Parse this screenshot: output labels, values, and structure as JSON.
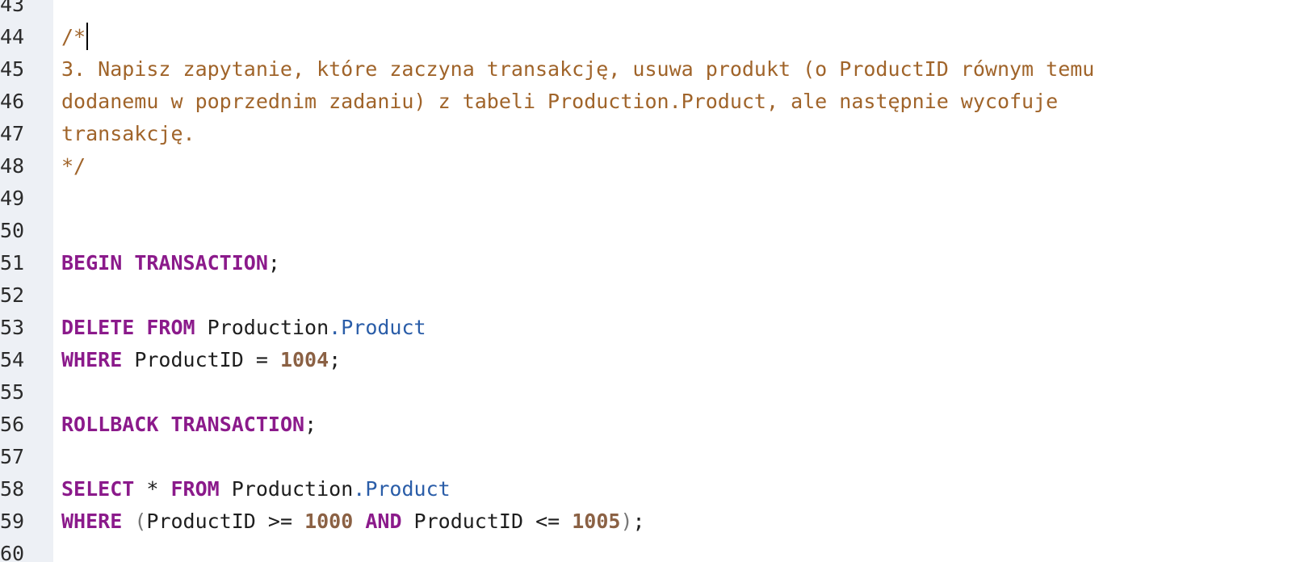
{
  "editor": {
    "lines": [
      {
        "num": "43",
        "tokens": []
      },
      {
        "num": "44",
        "tokens": [
          {
            "text": "/*",
            "cls": "c",
            "name": "comment-open"
          }
        ],
        "caret": true
      },
      {
        "num": "45",
        "tokens": [
          {
            "text": "3. Napisz zapytanie, które zaczyna transakcję, usuwa produkt (o ProductID równym temu",
            "cls": "c",
            "name": "comment-text"
          }
        ]
      },
      {
        "num": "46",
        "tokens": [
          {
            "text": "dodanemu w poprzednim zadaniu) z tabeli Production.Product, ale następnie wycofuje",
            "cls": "c",
            "name": "comment-text"
          }
        ]
      },
      {
        "num": "47",
        "tokens": [
          {
            "text": "transakcję.",
            "cls": "c",
            "name": "comment-text"
          }
        ]
      },
      {
        "num": "48",
        "tokens": [
          {
            "text": "*/",
            "cls": "c",
            "name": "comment-close"
          }
        ]
      },
      {
        "num": "49",
        "tokens": []
      },
      {
        "num": "50",
        "tokens": []
      },
      {
        "num": "51",
        "tokens": [
          {
            "text": "BEGIN",
            "cls": "k",
            "name": "keyword-begin"
          },
          {
            "text": " ",
            "cls": "t",
            "name": "space"
          },
          {
            "text": "TRANSACTION",
            "cls": "k",
            "name": "keyword-transaction"
          },
          {
            "text": ";",
            "cls": "t",
            "name": "semicolon"
          }
        ]
      },
      {
        "num": "52",
        "tokens": []
      },
      {
        "num": "53",
        "tokens": [
          {
            "text": "DELETE",
            "cls": "k",
            "name": "keyword-delete"
          },
          {
            "text": " ",
            "cls": "t",
            "name": "space"
          },
          {
            "text": "FROM",
            "cls": "k",
            "name": "keyword-from"
          },
          {
            "text": " Production",
            "cls": "t",
            "name": "schema-identifier"
          },
          {
            "text": ".Product",
            "cls": "m",
            "name": "table-identifier"
          }
        ]
      },
      {
        "num": "54",
        "tokens": [
          {
            "text": "WHERE",
            "cls": "k",
            "name": "keyword-where"
          },
          {
            "text": " ProductID = ",
            "cls": "t",
            "name": "condition-text"
          },
          {
            "text": "1004",
            "cls": "n",
            "name": "number-literal"
          },
          {
            "text": ";",
            "cls": "t",
            "name": "semicolon"
          }
        ]
      },
      {
        "num": "55",
        "tokens": []
      },
      {
        "num": "56",
        "tokens": [
          {
            "text": "ROLLBACK",
            "cls": "k",
            "name": "keyword-rollback"
          },
          {
            "text": " ",
            "cls": "t",
            "name": "space"
          },
          {
            "text": "TRANSACTION",
            "cls": "k",
            "name": "keyword-transaction"
          },
          {
            "text": ";",
            "cls": "t",
            "name": "semicolon"
          }
        ]
      },
      {
        "num": "57",
        "tokens": []
      },
      {
        "num": "58",
        "tokens": [
          {
            "text": "SELECT",
            "cls": "k",
            "name": "keyword-select"
          },
          {
            "text": " * ",
            "cls": "t",
            "name": "star-operator"
          },
          {
            "text": "FROM",
            "cls": "k",
            "name": "keyword-from"
          },
          {
            "text": " Production",
            "cls": "t",
            "name": "schema-identifier"
          },
          {
            "text": ".Product",
            "cls": "m",
            "name": "table-identifier"
          }
        ]
      },
      {
        "num": "59",
        "tokens": [
          {
            "text": "WHERE",
            "cls": "k",
            "name": "keyword-where"
          },
          {
            "text": " ",
            "cls": "t",
            "name": "space"
          },
          {
            "text": "(",
            "cls": "p",
            "name": "paren-open"
          },
          {
            "text": "ProductID >= ",
            "cls": "t",
            "name": "condition-text"
          },
          {
            "text": "1000",
            "cls": "n",
            "name": "number-literal"
          },
          {
            "text": " ",
            "cls": "t",
            "name": "space"
          },
          {
            "text": "AND",
            "cls": "k",
            "name": "keyword-and"
          },
          {
            "text": " ProductID <= ",
            "cls": "t",
            "name": "condition-text"
          },
          {
            "text": "1005",
            "cls": "n",
            "name": "number-literal"
          },
          {
            "text": ")",
            "cls": "p",
            "name": "paren-close"
          },
          {
            "text": ";",
            "cls": "t",
            "name": "semicolon"
          }
        ]
      },
      {
        "num": "60",
        "tokens": []
      }
    ],
    "colors": {
      "gutter_background": "#edf0f5",
      "comment": "#a0642a",
      "keyword": "#8b1a8b",
      "number": "#8b6144",
      "member": "#2a5da8"
    }
  }
}
